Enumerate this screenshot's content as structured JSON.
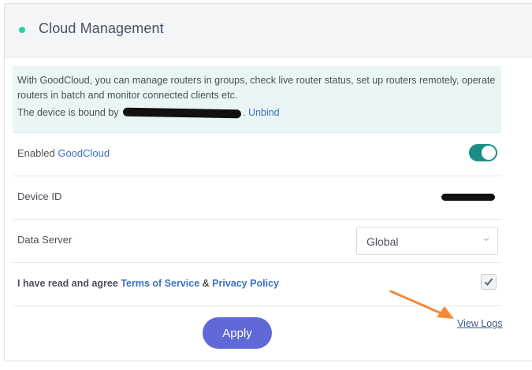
{
  "header": {
    "title": "Cloud Management",
    "status_color": "#22d3a6"
  },
  "info": {
    "description": "With GoodCloud, you can manage routers in groups, check live router status, set up routers remotely, operate routers in batch and monitor connected clients etc.",
    "bound_prefix": "The device is bound by",
    "bound_suffix": ".",
    "unbind_label": "Unbind"
  },
  "settings": {
    "enabled": {
      "label_prefix": "Enabled",
      "label_accent": "GoodCloud",
      "on": true,
      "on_color": "#1a8f86"
    },
    "device_id": {
      "label": "Device ID"
    },
    "data_server": {
      "label": "Data Server",
      "selected": "Global"
    },
    "agreement": {
      "prefix": "I have read and agree",
      "terms": "Terms of Service",
      "and": "&",
      "privacy": "Privacy Policy",
      "checked": true
    }
  },
  "actions": {
    "apply_label": "Apply",
    "apply_color": "#6169d8",
    "view_logs_label": "View Logs"
  },
  "annotation": {
    "arrow_color": "#f28a3a"
  }
}
